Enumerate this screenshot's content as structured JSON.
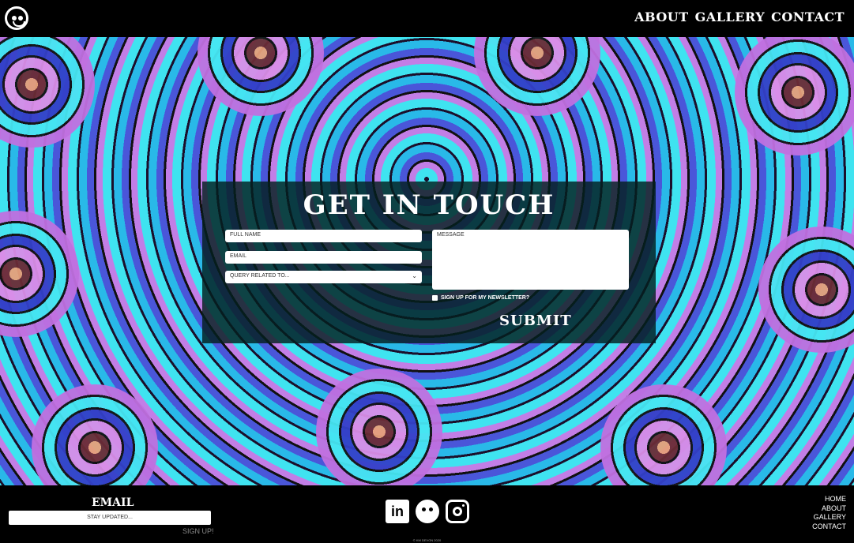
{
  "header": {
    "nav": [
      "ABOUT",
      "GALLERY",
      "CONTACT"
    ]
  },
  "form": {
    "title": "GET IN TOUCH",
    "full_name_placeholder": "FULL NAME",
    "email_placeholder": "EMAIL",
    "query_selected": "QUERY RELATED TO...",
    "message_placeholder": "MESSAGE",
    "newsletter_label": "SIGN UP FOR MY NEWSLETTER?",
    "submit_label": "SUBMIT"
  },
  "footer": {
    "email_title": "EMAIL",
    "email_placeholder": "STAY UPDATED...",
    "signup_label": "SIGN UP!",
    "copyright": "© KM DEVON 2020",
    "nav": [
      "HOME",
      "ABOUT",
      "GALLERY",
      "CONTACT"
    ],
    "social_icons": [
      "linkedin-icon",
      "monkey-logo-icon",
      "instagram-icon"
    ]
  },
  "colors": {
    "background": "#000000",
    "card_overlay": "#04201e",
    "accent_cyan": "#2ac0e6",
    "accent_purple": "#c27ee6"
  }
}
